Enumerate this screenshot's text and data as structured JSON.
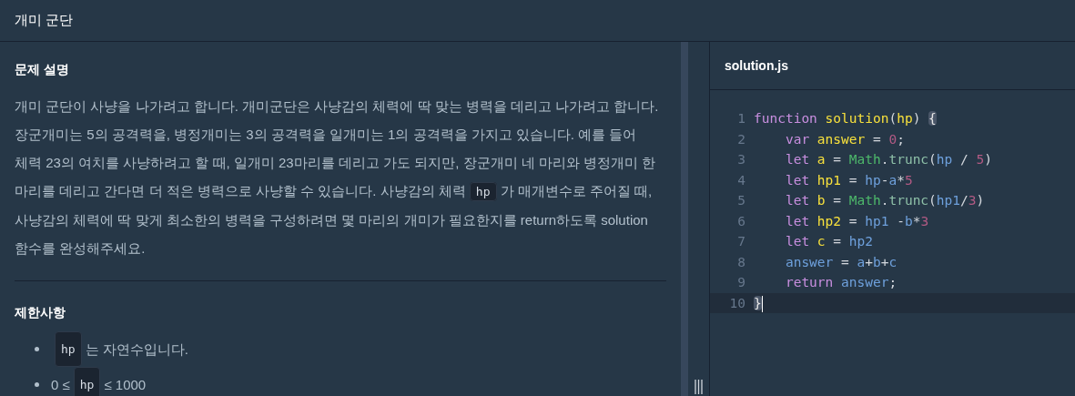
{
  "title": "개미 군단",
  "description": {
    "heading": "문제 설명",
    "segments": [
      {
        "kind": "text",
        "text": "개미 군단이 사냥을 나가려고 합니다. 개미군단은 사냥감의 체력에 딱 맞는 병력을 데리고 나가려고 합니다. 장군개미는 5의 공격력을, 병정개미는 3의 공격력을 일개미는 1의 공격력을 가지고 있습니다. 예를 들어 체력 23의 여치를 사냥하려고 할 때, 일개미 23마리를 데리고 가도 되지만, 장군개미 네 마리와 병정개미 한 마리를 데리고 간다면 더 적은 병력으로 사냥할 수 있습니다. 사냥감의 체력"
      },
      {
        "kind": "code",
        "text": "hp"
      },
      {
        "kind": "text",
        "text": "가 매개변수로 주어질 때, 사냥감의 체력에 딱 맞게 최소한의 병력을 구성하려면 몇 마리의 개미가 필요한지를 return하도록 solution 함수를 완성해주세요."
      }
    ]
  },
  "constraints": {
    "heading": "제한사항",
    "items": [
      [
        {
          "kind": "code",
          "text": "hp"
        },
        {
          "kind": "text",
          "text": "는 자연수입니다."
        }
      ],
      [
        {
          "kind": "text",
          "text": "0 ≤"
        },
        {
          "kind": "code",
          "text": "hp"
        },
        {
          "kind": "text",
          "text": "≤ 1000"
        }
      ]
    ]
  },
  "editor": {
    "filename": "solution.js",
    "lines": [
      {
        "number": "1",
        "tokens": [
          {
            "kind": "keyword",
            "text": "function "
          },
          {
            "kind": "def",
            "text": "solution"
          },
          {
            "kind": "punc",
            "text": "("
          },
          {
            "kind": "def",
            "text": "hp"
          },
          {
            "kind": "punc",
            "text": ") "
          },
          {
            "kind": "bracket",
            "text": "{"
          }
        ]
      },
      {
        "number": "2",
        "tokens": [
          {
            "kind": "keyword",
            "text": "    var "
          },
          {
            "kind": "def",
            "text": "answer"
          },
          {
            "kind": "punc",
            "text": " = "
          },
          {
            "kind": "num",
            "text": "0"
          },
          {
            "kind": "punc",
            "text": ";"
          }
        ]
      },
      {
        "number": "3",
        "tokens": [
          {
            "kind": "keyword",
            "text": "    let "
          },
          {
            "kind": "def",
            "text": "a"
          },
          {
            "kind": "punc",
            "text": " = "
          },
          {
            "kind": "builtin",
            "text": "Math"
          },
          {
            "kind": "punc",
            "text": "."
          },
          {
            "kind": "prop",
            "text": "trunc"
          },
          {
            "kind": "punc",
            "text": "("
          },
          {
            "kind": "var",
            "text": "hp"
          },
          {
            "kind": "punc",
            "text": " / "
          },
          {
            "kind": "num",
            "text": "5"
          },
          {
            "kind": "punc",
            "text": ")"
          }
        ]
      },
      {
        "number": "4",
        "tokens": [
          {
            "kind": "keyword",
            "text": "    let "
          },
          {
            "kind": "def",
            "text": "hp1"
          },
          {
            "kind": "punc",
            "text": " = "
          },
          {
            "kind": "var",
            "text": "hp"
          },
          {
            "kind": "punc",
            "text": "-"
          },
          {
            "kind": "var",
            "text": "a"
          },
          {
            "kind": "punc",
            "text": "*"
          },
          {
            "kind": "num",
            "text": "5"
          }
        ]
      },
      {
        "number": "5",
        "tokens": [
          {
            "kind": "keyword",
            "text": "    let "
          },
          {
            "kind": "def",
            "text": "b"
          },
          {
            "kind": "punc",
            "text": " = "
          },
          {
            "kind": "builtin",
            "text": "Math"
          },
          {
            "kind": "punc",
            "text": "."
          },
          {
            "kind": "prop",
            "text": "trunc"
          },
          {
            "kind": "punc",
            "text": "("
          },
          {
            "kind": "var",
            "text": "hp1"
          },
          {
            "kind": "punc",
            "text": "/"
          },
          {
            "kind": "num",
            "text": "3"
          },
          {
            "kind": "punc",
            "text": ")"
          }
        ]
      },
      {
        "number": "6",
        "tokens": [
          {
            "kind": "keyword",
            "text": "    let "
          },
          {
            "kind": "def",
            "text": "hp2"
          },
          {
            "kind": "punc",
            "text": " = "
          },
          {
            "kind": "var",
            "text": "hp1"
          },
          {
            "kind": "punc",
            "text": " -"
          },
          {
            "kind": "var",
            "text": "b"
          },
          {
            "kind": "punc",
            "text": "*"
          },
          {
            "kind": "num",
            "text": "3"
          }
        ]
      },
      {
        "number": "7",
        "tokens": [
          {
            "kind": "keyword",
            "text": "    let "
          },
          {
            "kind": "def",
            "text": "c"
          },
          {
            "kind": "punc",
            "text": " = "
          },
          {
            "kind": "var",
            "text": "hp2"
          }
        ]
      },
      {
        "number": "8",
        "tokens": [
          {
            "kind": "var",
            "text": "    answer"
          },
          {
            "kind": "punc",
            "text": " = "
          },
          {
            "kind": "var",
            "text": "a"
          },
          {
            "kind": "punc",
            "text": "+"
          },
          {
            "kind": "var",
            "text": "b"
          },
          {
            "kind": "punc",
            "text": "+"
          },
          {
            "kind": "var",
            "text": "c"
          }
        ]
      },
      {
        "number": "9",
        "tokens": [
          {
            "kind": "keyword",
            "text": "    return "
          },
          {
            "kind": "var",
            "text": "answer"
          },
          {
            "kind": "punc",
            "text": ";"
          }
        ]
      },
      {
        "number": "10",
        "active": true,
        "tokens": [
          {
            "kind": "bracket",
            "text": "}"
          }
        ]
      }
    ]
  }
}
